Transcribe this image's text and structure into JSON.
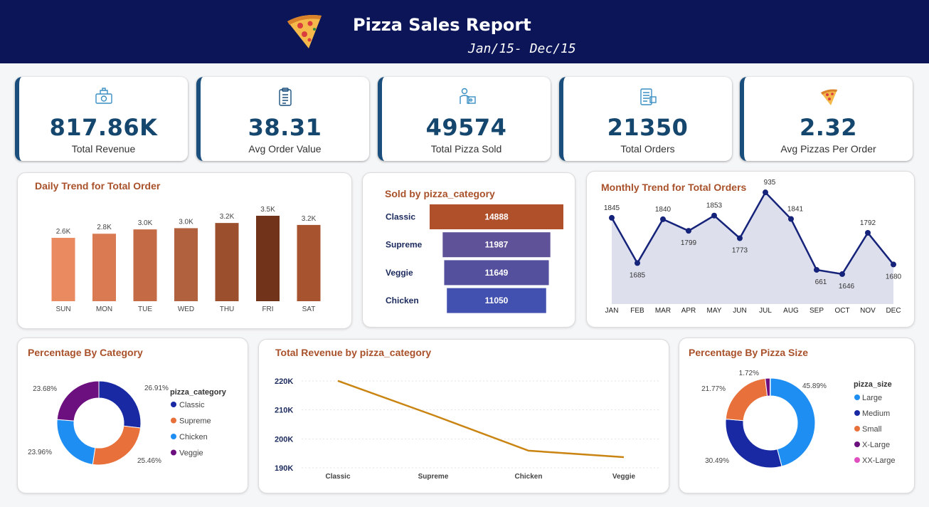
{
  "header": {
    "title": "Pizza Sales Report",
    "date_range": "Jan/15- Dec/15"
  },
  "kpis": [
    {
      "value": "817.86K",
      "label": "Total Revenue",
      "icon": "money-icon"
    },
    {
      "value": "38.31",
      "label": "Avg Order Value",
      "icon": "clipboard-icon"
    },
    {
      "value": "49574",
      "label": "Total Pizza Sold",
      "icon": "delivery-icon"
    },
    {
      "value": "21350",
      "label": "Total Orders",
      "icon": "order-list-icon"
    },
    {
      "value": "2.32",
      "label": "Avg Pizzas Per Order",
      "icon": "pizza-slice-icon"
    }
  ],
  "colors": {
    "header_bg": "#0b1557",
    "kpi_accent": "#1a4f7d",
    "title_color": "#a8512a"
  },
  "chart_data": [
    {
      "id": "daily",
      "type": "bar",
      "title": "Daily Trend for Total Order",
      "categories": [
        "SUN",
        "MON",
        "TUE",
        "WED",
        "THU",
        "FRI",
        "SAT"
      ],
      "values": [
        2624,
        2794,
        2973,
        3024,
        3239,
        3538,
        3158
      ],
      "data_labels": [
        "2.6K",
        "2.8K",
        "3.0K",
        "3.0K",
        "3.2K",
        "3.5K",
        "3.2K"
      ],
      "colors": [
        "#ea8a61",
        "#d97a52",
        "#c46a45",
        "#b2613f",
        "#9c4f2d",
        "#72331b",
        "#a8532f"
      ]
    },
    {
      "id": "category_sold",
      "type": "bar",
      "title": "Sold by pizza_category",
      "categories": [
        "Classic",
        "Supreme",
        "Veggie",
        "Chicken"
      ],
      "values": [
        14888,
        11987,
        11649,
        11050
      ],
      "colors": [
        "#b0502a",
        "#5f5298",
        "#54509e",
        "#4250b0"
      ]
    },
    {
      "id": "monthly",
      "type": "area",
      "title": "Monthly Trend for Total Orders",
      "categories": [
        "JAN",
        "FEB",
        "MAR",
        "APR",
        "MAY",
        "JUN",
        "JUL",
        "AUG",
        "SEP",
        "OCT",
        "NOV",
        "DEC"
      ],
      "values": [
        1845,
        1685,
        1840,
        1799,
        1853,
        1773,
        1935,
        1841,
        1661,
        1646,
        1792,
        1680
      ],
      "data_labels": [
        "1845",
        "1685",
        "1840",
        "1799",
        "1853",
        "1773",
        "935",
        "1841",
        "661",
        "1646",
        "1792",
        "1680"
      ]
    },
    {
      "id": "pct_category",
      "type": "pie",
      "title": "Percentage By Category",
      "legend_title": "pizza_category",
      "labels": [
        "Classic",
        "Supreme",
        "Chicken",
        "Veggie"
      ],
      "values": [
        26.91,
        25.46,
        23.96,
        23.68
      ],
      "value_labels": [
        "26.91%",
        "25.46%",
        "23.96%",
        "23.68%"
      ],
      "colors": [
        "#1829a3",
        "#e8703a",
        "#1f8ef2",
        "#6c0f7f"
      ]
    },
    {
      "id": "revenue_category",
      "type": "line",
      "title": "Total Revenue by pizza_category",
      "categories": [
        "Classic",
        "Supreme",
        "Chicken",
        "Veggie"
      ],
      "values": [
        220053,
        208197,
        195920,
        193690
      ],
      "yticks": [
        "190K",
        "200K",
        "210K",
        "220K"
      ],
      "ylim": [
        190000,
        222000
      ],
      "color": "#c98412"
    },
    {
      "id": "pct_size",
      "type": "pie",
      "title": "Percentage By Pizza Size",
      "legend_title": "pizza_size",
      "labels": [
        "Large",
        "Medium",
        "Small",
        "X-Large",
        "XX-Large"
      ],
      "values": [
        45.89,
        30.49,
        21.77,
        1.72,
        0.12
      ],
      "value_labels": [
        "45.89%",
        "30.49%",
        "21.77%",
        "1.72%",
        ""
      ],
      "colors": [
        "#1f8ef2",
        "#1829a3",
        "#e8703a",
        "#6c0f7f",
        "#e04fc0"
      ]
    }
  ]
}
